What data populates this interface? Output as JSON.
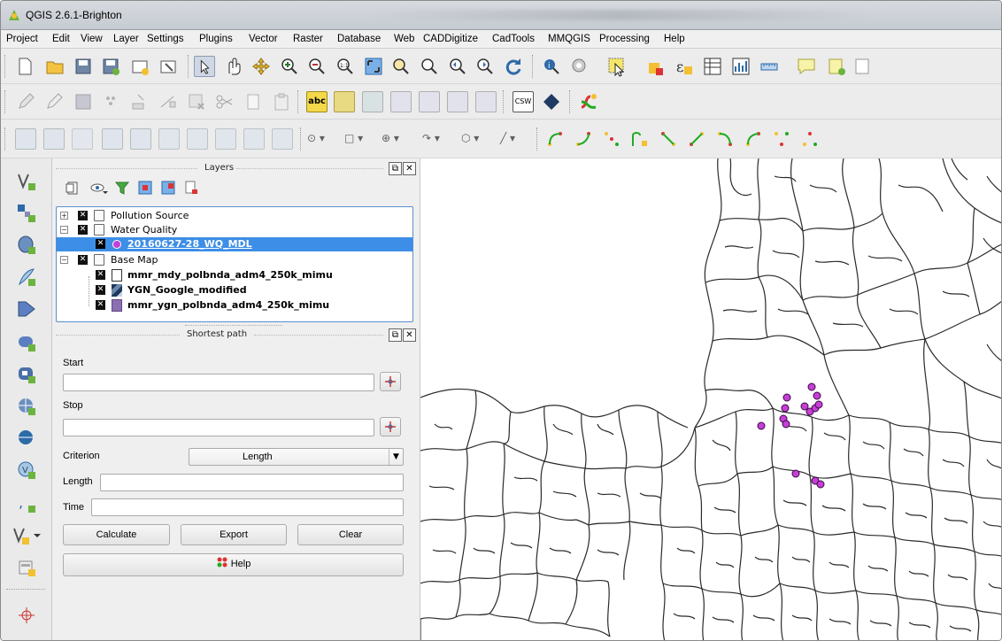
{
  "window": {
    "title": "QGIS 2.6.1-Brighton"
  },
  "menu": [
    "Project",
    "Edit",
    "View",
    "Layer",
    "Settings",
    "Plugins",
    "Vector",
    "Raster",
    "Database",
    "Web",
    "CADDigitize",
    "CadTools",
    "MMQGIS",
    "Processing",
    "Help"
  ],
  "layers_panel": {
    "title": "Layers",
    "items": [
      {
        "label": "Pollution Source"
      },
      {
        "label": "Water Quality"
      },
      {
        "label": "20160627-28_WQ_MDL"
      },
      {
        "label": "Base Map"
      },
      {
        "label": "mmr_mdy_polbnda_adm4_250k_mimu"
      },
      {
        "label": "YGN_Google_modified"
      },
      {
        "label": "mmr_ygn_polbnda_adm4_250k_mimu"
      }
    ]
  },
  "shortest_path": {
    "title": "Shortest path",
    "start_label": "Start",
    "stop_label": "Stop",
    "criterion_label": "Criterion",
    "criterion_value": "Length",
    "length_label": "Length",
    "time_label": "Time",
    "calculate": "Calculate",
    "export": "Export",
    "clear": "Clear",
    "help": "Help"
  },
  "toolbar_labels": {
    "abc": "abc",
    "csw": "CSW"
  },
  "colors": {
    "selection": "#3d8ee6",
    "points": "#c53fd6",
    "map_bg": "#ffffff",
    "line": "#2a2a2a"
  }
}
